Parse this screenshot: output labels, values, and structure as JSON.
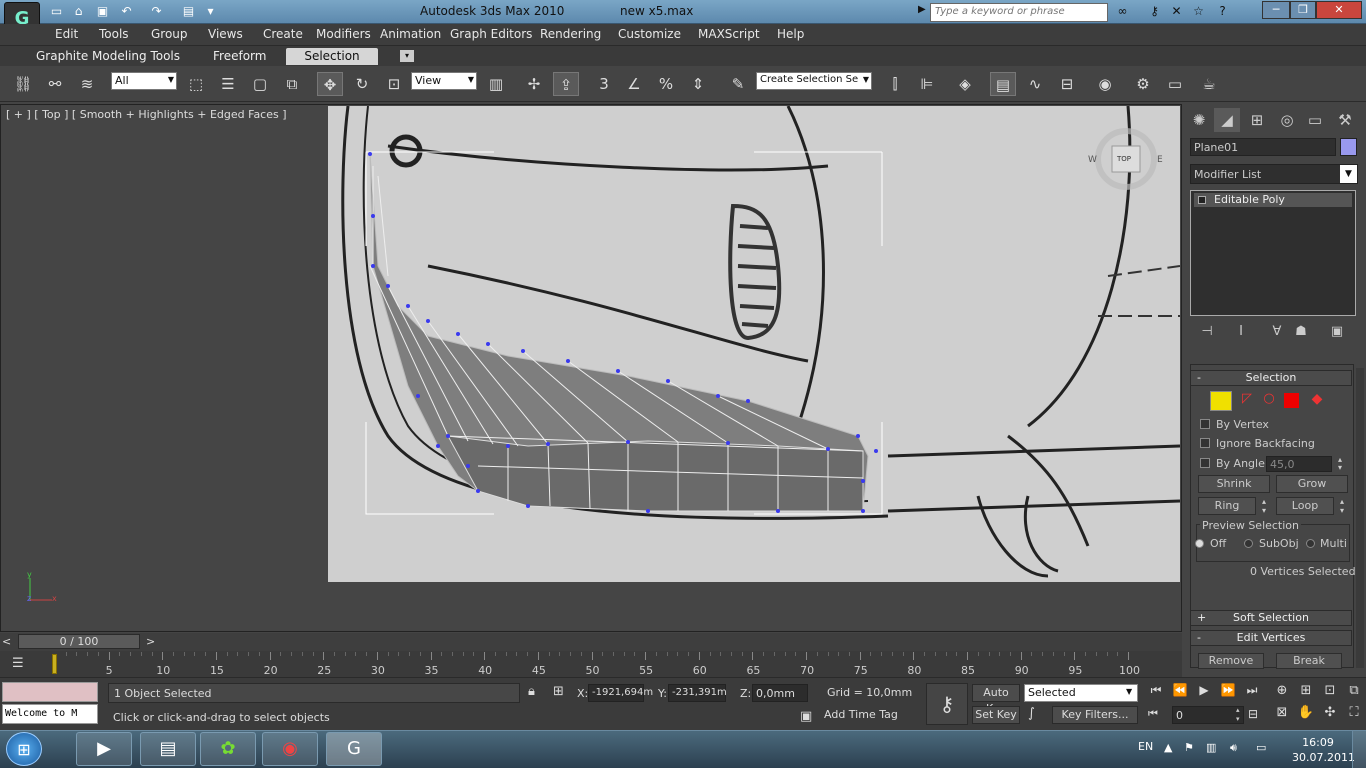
{
  "titlebar": {
    "app_title": "Autodesk 3ds Max  2010",
    "file_name": "new x5.max",
    "search_placeholder": "Type a keyword or phrase",
    "quick_access_icons": [
      "new-file-icon",
      "open-folder-icon",
      "save-icon",
      "undo-icon",
      "redo-icon",
      "project-folder-icon",
      "dropdown-arrow-icon"
    ],
    "help_icons": [
      "binoculars-icon",
      "key-icon",
      "star-icon",
      "help-icon"
    ],
    "window_buttons": [
      "minimize-icon",
      "restore-icon",
      "close-icon"
    ]
  },
  "menubar": {
    "items": [
      "Edit",
      "Tools",
      "Group",
      "Views",
      "Create",
      "Modifiers",
      "Animation",
      "Graph Editors",
      "Rendering",
      "Customize",
      "MAXScript",
      "Help"
    ]
  },
  "ribbon": {
    "tabs": [
      "Graphite Modeling Tools",
      "Freeform",
      "Selection"
    ],
    "active_tab": "Selection"
  },
  "toolbar": {
    "selection_filter": "All",
    "reference_coord": "View",
    "named_selection_placeholder": "Create Selection Se",
    "snap_label": "3",
    "angle_label": "",
    "icons": [
      "select-and-link-icon",
      "unlink-icon",
      "bind-space-warp-icon",
      "select-object-icon",
      "select-by-name-icon",
      "rect-selection-icon",
      "window-crossing-icon",
      "select-move-icon",
      "select-rotate-icon",
      "select-scale-icon",
      "pivot-icon",
      "manipulate-icon",
      "keyboard-shortcut-icon",
      "snap-toggle-icon",
      "angle-snap-icon",
      "percent-snap-icon",
      "spinner-snap-icon",
      "edit-named-sel-icon",
      "mirror-icon",
      "align-icon",
      "layer-manager-icon",
      "graphite-toggle-icon",
      "curve-editor-icon",
      "schematic-view-icon",
      "material-editor-icon",
      "render-setup-icon",
      "rendered-frame-icon",
      "render-icon"
    ]
  },
  "viewport": {
    "label": "[ + ] [ Top ] [ Smooth + Highlights + Edged Faces ]",
    "viewcube_label": "TOP",
    "compass": [
      "W",
      "E"
    ],
    "gizmo": [
      "y",
      "x",
      "z"
    ]
  },
  "command_panel": {
    "tab_icons": [
      "create-tab-icon",
      "modify-tab-icon",
      "hierarchy-tab-icon",
      "motion-tab-icon",
      "display-tab-icon",
      "utilities-tab-icon"
    ],
    "object_name": "Plane01",
    "object_color": "#9999ee",
    "modifier_list": "Modifier List",
    "stack_item": "Editable Poly",
    "stack_tools": [
      "pin-stack-icon",
      "show-end-result-icon",
      "make-unique-icon",
      "remove-modifier-icon",
      "configure-sets-icon"
    ],
    "selection_rollout": {
      "title": "Selection",
      "subobject_icons": [
        "vertex-icon",
        "edge-icon",
        "border-icon",
        "polygon-icon",
        "element-icon"
      ],
      "by_vertex": "By Vertex",
      "ignore_backfacing": "Ignore Backfacing",
      "by_angle": "By Angle:",
      "angle_value": "45,0",
      "shrink": "Shrink",
      "grow": "Grow",
      "ring": "Ring",
      "loop": "Loop",
      "preview_title": "Preview Selection",
      "preview_options": [
        "Off",
        "SubObj",
        "Multi"
      ],
      "preview_selected": "Off",
      "status": "0 Vertices Selected"
    },
    "soft_selection": "Soft Selection",
    "edit_vertices": "Edit Vertices",
    "remove": "Remove",
    "break": "Break"
  },
  "timeline": {
    "frame_display": "0 / 100",
    "current_frame": 0,
    "ticks": [
      "5",
      "10",
      "15",
      "20",
      "25",
      "30",
      "35",
      "40",
      "45",
      "50",
      "55",
      "60",
      "65",
      "70",
      "75",
      "80",
      "85",
      "90",
      "95",
      "100"
    ]
  },
  "statusbar": {
    "listener_text": "Welcome to M",
    "selection_status": "1 Object Selected",
    "prompt": "Click or click-and-drag to select objects",
    "x_label": "X:",
    "x_value": "-1921,694m",
    "y_label": "Y:",
    "y_value": "-231,391m",
    "z_label": "Z:",
    "z_value": "0,0mm",
    "grid": "Grid = 10,0mm",
    "add_time_tag": "Add Time Tag",
    "auto_key": "Auto Key",
    "set_key": "Set Key",
    "selected_set": "Selected",
    "key_filters": "Key Filters...",
    "frame_field": "0"
  },
  "taskbar": {
    "apps": [
      "media-player-icon",
      "file-explorer-icon",
      "icq-icon",
      "chrome-icon",
      "3dsmax-icon"
    ],
    "language": "EN",
    "time": "16:09",
    "date": "30.07.2011"
  }
}
